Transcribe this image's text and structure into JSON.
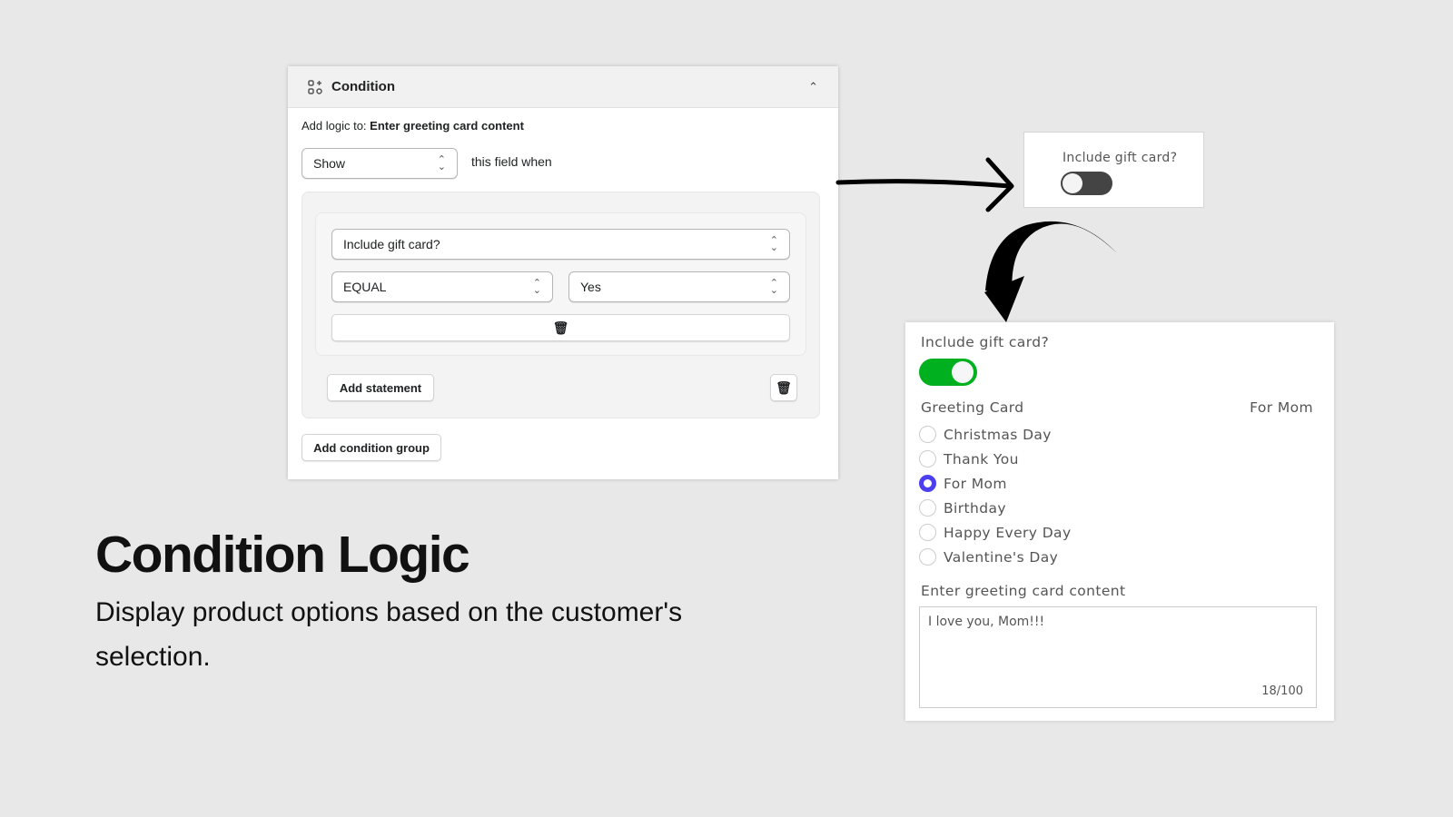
{
  "condition_panel": {
    "title": "Condition",
    "add_logic_prefix": "Add logic to:",
    "add_logic_target": "Enter greeting card content",
    "action_select": "Show",
    "action_suffix": "this field when",
    "field_select": "Include gift card?",
    "operator_select": "EQUAL",
    "value_select": "Yes",
    "add_statement": "Add statement",
    "add_condition_group": "Add condition group"
  },
  "preview_off": {
    "label": "Include gift card?",
    "toggle_on": false
  },
  "preview_on": {
    "toggle_label": "Include gift card?",
    "toggle_on": true,
    "toggle_color": "#00b01f",
    "greeting_label": "Greeting Card",
    "greeting_selected": "For Mom",
    "options": [
      "Christmas Day",
      "Thank You",
      "For Mom",
      "Birthday",
      "Happy Every Day",
      "Valentine's Day"
    ],
    "selected_index": 2,
    "radio_color": "#4c3ff0",
    "content_label": "Enter greeting card content",
    "content_value": "I love you, Mom!!!",
    "char_count": "18/100"
  },
  "headline": {
    "title": "Condition Logic",
    "subtitle": "Display product options based on the customer's selection."
  }
}
